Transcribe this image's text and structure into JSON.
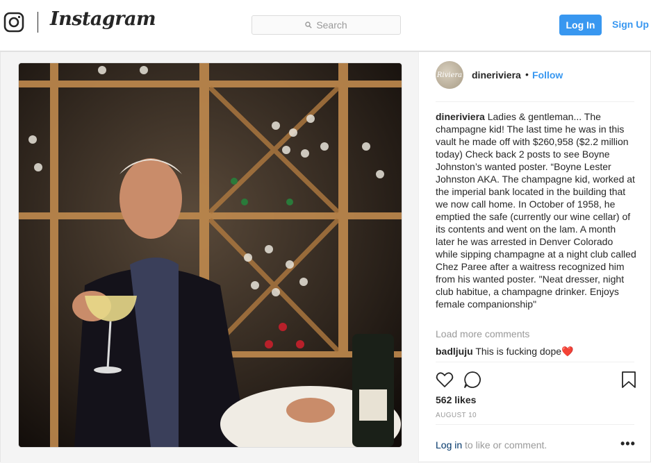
{
  "header": {
    "wordmark": "Instagram",
    "search_placeholder": "Search",
    "login_label": "Log In",
    "signup_label": "Sign Up"
  },
  "post": {
    "avatar_text": "Riviera",
    "username": "dineriviera",
    "separator": "•",
    "follow_label": "Follow",
    "caption_user": "dineriviera",
    "caption_text": "Ladies & gentleman... The champagne kid! The last time he was in this vault he made off with $260,958 ($2.2 million today) Check back 2 posts to see Boyne Johnston’s wanted poster. “Boyne Lester Johnston AKA. The champagne kid, worked at the imperial bank located in the building that we now call home. In October of 1958, he emptied the safe (currently our wine cellar) of its contents and went on the lam. A month later he was arrested in Denver Colorado while sipping champagne at a night club called Chez Paree after a waitress recognized him from his wanted poster. \"Neat dresser, night club habitue, a champagne drinker. Enjoys female companionship\"",
    "load_more": "Load more comments",
    "comments": [
      {
        "user": "badljuju",
        "text": "This is fucking dope❤️"
      }
    ],
    "likes": "562 likes",
    "date": "AUGUST 10",
    "login_link": "Log in",
    "login_suffix": " to like or comment.",
    "more_label": "•••"
  },
  "colors": {
    "accent": "#3897f0",
    "border": "#dbdbdb",
    "muted": "#999999"
  }
}
